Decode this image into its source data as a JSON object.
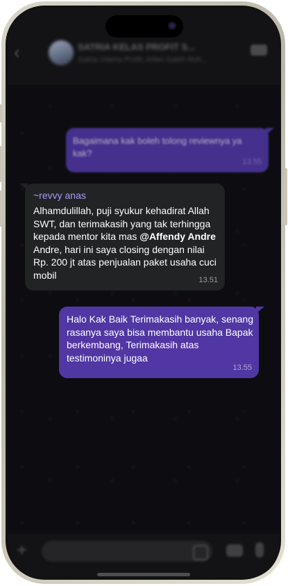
{
  "header": {
    "group_name": "SATRIA KELAS PROFIT S...",
    "group_members": "Satria Utama Profit, Arlen Saleh Roh...",
    "back_icon": "chevron-left-icon",
    "call_icon": "video-call-icon"
  },
  "messages": [
    {
      "direction": "outgoing",
      "text": "Bagaimana kak boleh tolong reviewnya ya kak?",
      "time": "13.55"
    },
    {
      "direction": "incoming",
      "sender": "~revvy anas",
      "text_before_mention": "Alhamdulillah, puji syukur kehadirat Allah SWT, dan terimakasih yang tak terhingga kepada mentor kita mas ",
      "mention": "@Affendy Andre",
      "text_after_mention": " Andre, hari ini saya closing dengan nilai Rp. 200 jt atas penjualan paket usaha cuci mobil",
      "time": "13.51"
    },
    {
      "direction": "outgoing",
      "text": "Halo Kak Baik Terimakasih banyak, senang rasanya saya bisa membantu usaha Bapak berkembang, Terimakasih atas testimoninya jugaa",
      "time": "13.55"
    }
  ],
  "input_bar": {
    "plus_icon": "plus-icon",
    "sticker_icon": "sticker-icon",
    "camera_icon": "camera-icon",
    "mic_icon": "microphone-icon"
  },
  "colors": {
    "outgoing_bubble": "#5037a3",
    "incoming_bubble": "#212325",
    "sender_name": "#a99cf3",
    "phone_frame": "#d9d6c9"
  }
}
